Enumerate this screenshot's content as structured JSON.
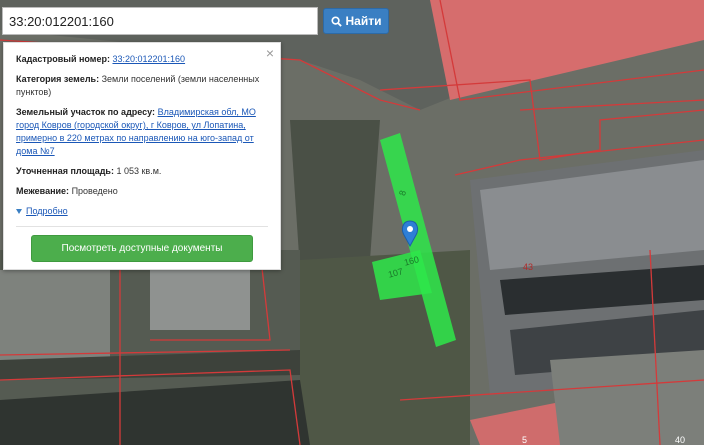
{
  "search": {
    "value": "33:20:012201:160",
    "button_label": "Найти",
    "button_icon": "search-icon"
  },
  "panel": {
    "cadastral_label": "Кадастровый номер:",
    "cadastral_value": "33:20:012201:160",
    "category_label": "Категория земель:",
    "category_value": "Земли поселений (земли населенных пунктов)",
    "address_label": "Земельный участок по адресу:",
    "address_value": "Владимирская обл, МО город Ковров (городской округ), г Ковров, ул Лопатина, примерно в 220 метрах по направлению на юго-запад от дома №7",
    "area_label": "Уточненная площадь:",
    "area_value": "1 053 кв.м.",
    "survey_label": "Межевание:",
    "survey_value": "Проведено",
    "more_label": "Подробно",
    "docs_button": "Посмотреть доступные документы",
    "close_label": "×"
  },
  "map": {
    "parcel_labels": [
      "8",
      "160",
      "107"
    ],
    "building_number": "43",
    "corner_labels": [
      "5",
      "40"
    ]
  },
  "colors": {
    "accent_blue": "#3a7fc3",
    "button_green": "#4cae4c",
    "parcel_green": "#2ee84a",
    "building_red": "#e36c6c"
  }
}
